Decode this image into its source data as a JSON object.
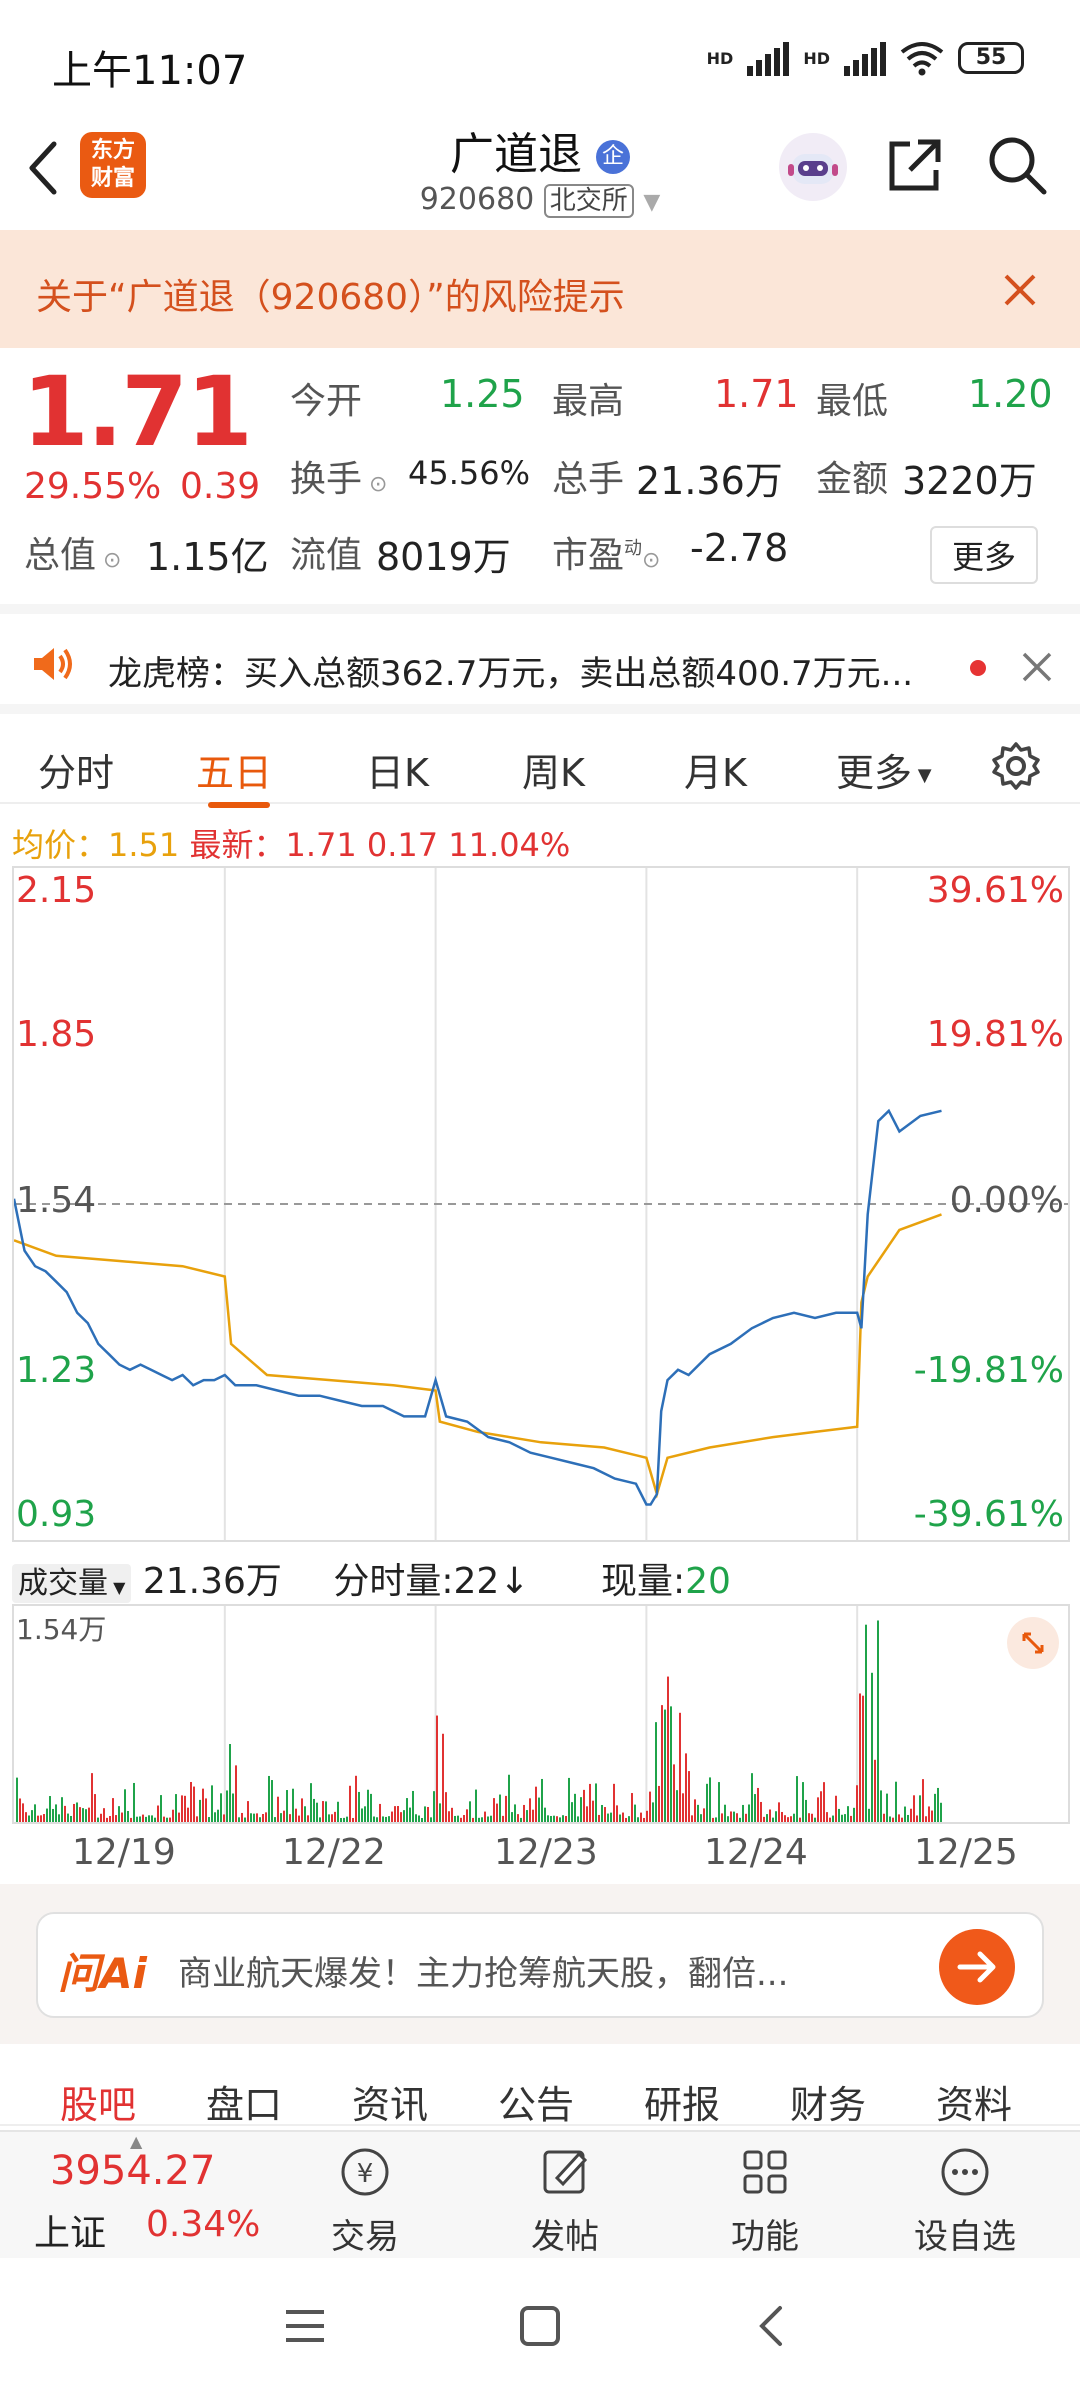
{
  "status": {
    "time": "上午11:07",
    "battery": "55",
    "hd1": "HD",
    "hd2": "HD"
  },
  "header": {
    "logo": [
      "东方",
      "财富"
    ],
    "title": "广道退",
    "badge": "企",
    "code": "920680",
    "exchange": "北交所"
  },
  "warning": {
    "text": "关于“广道退（920680）”的风险提示"
  },
  "quote": {
    "price": "1.71",
    "change_pct": "29.55%",
    "change": "0.39",
    "open_label": "今开",
    "open": "1.25",
    "high_label": "最高",
    "high": "1.71",
    "low_label": "最低",
    "low": "1.20",
    "turnover_label": "换手",
    "turnover": "45.56%",
    "volume_label": "总手",
    "volume": "21.36万",
    "amount_label": "金额",
    "amount": "3220万",
    "mktcap_label": "总值",
    "mktcap": "1.15亿",
    "float_label": "流值",
    "float": "8019万",
    "pe_label": "市盈",
    "pe_sup": "动",
    "pe": "-2.78",
    "more_btn": "更多"
  },
  "notice": {
    "text": "龙虎榜：买入总额362.7万元，卖出总额400.7万元..."
  },
  "tabs": [
    "分时",
    "五日",
    "日K",
    "周K",
    "月K",
    "更多"
  ],
  "info": {
    "avg_label": "均价：",
    "avg": "1.51",
    "latest_label": "最新：",
    "latest": "1.71",
    "chg": "0.17",
    "chg_pct": "11.04%"
  },
  "chart_data": {
    "type": "line",
    "title": "",
    "x_labels": [
      "12/19",
      "12/22",
      "12/23",
      "12/24",
      "12/25"
    ],
    "y_left_ticks": [
      "2.15",
      "1.85",
      "1.54",
      "1.23",
      "0.93"
    ],
    "y_right_ticks": [
      "39.61%",
      "19.81%",
      "0.00%",
      "-19.81%",
      "-39.61%"
    ],
    "ylim": [
      0.93,
      2.15
    ],
    "series": [],
    "price": [
      [
        0.0,
        1.55
      ],
      [
        0.05,
        1.45
      ],
      [
        0.1,
        1.42
      ],
      [
        0.15,
        1.41
      ],
      [
        0.2,
        1.39
      ],
      [
        0.25,
        1.37
      ],
      [
        0.3,
        1.33
      ],
      [
        0.35,
        1.31
      ],
      [
        0.4,
        1.27
      ],
      [
        0.45,
        1.25
      ],
      [
        0.5,
        1.23
      ],
      [
        0.55,
        1.22
      ],
      [
        0.6,
        1.23
      ],
      [
        0.65,
        1.22
      ],
      [
        0.7,
        1.21
      ],
      [
        0.75,
        1.2
      ],
      [
        0.8,
        1.21
      ],
      [
        0.85,
        1.19
      ],
      [
        0.9,
        1.2
      ],
      [
        0.95,
        1.2
      ],
      [
        1.0,
        1.21
      ],
      [
        1.05,
        1.19
      ],
      [
        1.15,
        1.19
      ],
      [
        1.25,
        1.18
      ],
      [
        1.35,
        1.17
      ],
      [
        1.45,
        1.17
      ],
      [
        1.55,
        1.16
      ],
      [
        1.65,
        1.15
      ],
      [
        1.75,
        1.15
      ],
      [
        1.85,
        1.13
      ],
      [
        1.95,
        1.13
      ],
      [
        2.0,
        1.2
      ],
      [
        2.05,
        1.13
      ],
      [
        2.15,
        1.12
      ],
      [
        2.25,
        1.09
      ],
      [
        2.35,
        1.08
      ],
      [
        2.45,
        1.06
      ],
      [
        2.55,
        1.05
      ],
      [
        2.65,
        1.04
      ],
      [
        2.75,
        1.03
      ],
      [
        2.85,
        1.01
      ],
      [
        2.95,
        1.0
      ],
      [
        3.0,
        0.96
      ],
      [
        3.02,
        0.96
      ],
      [
        3.05,
        0.98
      ],
      [
        3.07,
        1.14
      ],
      [
        3.1,
        1.2
      ],
      [
        3.15,
        1.22
      ],
      [
        3.2,
        1.21
      ],
      [
        3.3,
        1.25
      ],
      [
        3.4,
        1.27
      ],
      [
        3.5,
        1.3
      ],
      [
        3.6,
        1.32
      ],
      [
        3.7,
        1.33
      ],
      [
        3.8,
        1.32
      ],
      [
        3.9,
        1.33
      ],
      [
        4.0,
        1.33
      ],
      [
        4.02,
        1.3
      ],
      [
        4.05,
        1.52
      ],
      [
        4.1,
        1.7
      ],
      [
        4.15,
        1.72
      ],
      [
        4.2,
        1.68
      ],
      [
        4.3,
        1.71
      ],
      [
        4.4,
        1.72
      ]
    ],
    "avg": [
      [
        0.0,
        1.47
      ],
      [
        0.2,
        1.44
      ],
      [
        0.5,
        1.43
      ],
      [
        0.8,
        1.42
      ],
      [
        1.0,
        1.4
      ],
      [
        1.03,
        1.27
      ],
      [
        1.2,
        1.21
      ],
      [
        1.5,
        1.2
      ],
      [
        1.8,
        1.19
      ],
      [
        2.0,
        1.18
      ],
      [
        2.02,
        1.12
      ],
      [
        2.2,
        1.1
      ],
      [
        2.5,
        1.08
      ],
      [
        2.8,
        1.07
      ],
      [
        3.0,
        1.05
      ],
      [
        3.05,
        0.98
      ],
      [
        3.1,
        1.05
      ],
      [
        3.3,
        1.07
      ],
      [
        3.6,
        1.09
      ],
      [
        3.8,
        1.1
      ],
      [
        4.0,
        1.11
      ],
      [
        4.02,
        1.35
      ],
      [
        4.05,
        1.4
      ],
      [
        4.2,
        1.49
      ],
      [
        4.4,
        1.52
      ]
    ]
  },
  "volume": {
    "label": "成交量",
    "total": "21.36万",
    "tick_label": "分时量:",
    "tick": "22",
    "tick_arrow": "↓",
    "now_label": "现量:",
    "now": "20",
    "ymax": "1.54万"
  },
  "ai": {
    "brand": "问Ai",
    "text": "商业航天爆发！主力抢筹航天股，翻倍..."
  },
  "subtabs": [
    "股吧",
    "盘口",
    "资讯",
    "公告",
    "研报",
    "财务",
    "资料"
  ],
  "bottom": {
    "index_value": "3954.27",
    "index_name": "上证",
    "index_chg": "0.34%",
    "items": [
      "交易",
      "发帖",
      "功能",
      "设自选"
    ],
    "trade_icon_glyph": "¥"
  }
}
